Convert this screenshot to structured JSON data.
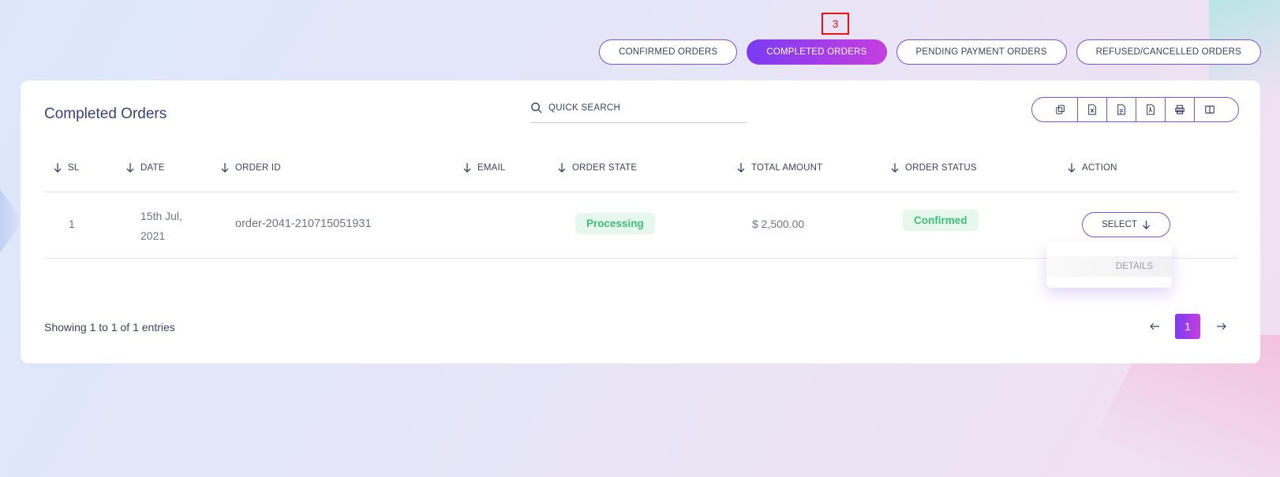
{
  "annotation_marker": "3",
  "tabs": [
    {
      "label": "CONFIRMED ORDERS",
      "active": false
    },
    {
      "label": "COMPLETED ORDERS",
      "active": true
    },
    {
      "label": "PENDING PAYMENT ORDERS",
      "active": false
    },
    {
      "label": "REFUSED/CANCELLED ORDERS",
      "active": false
    }
  ],
  "card": {
    "title": "Completed Orders",
    "search_label": "QUICK SEARCH",
    "toolbar_icons": [
      "copy-icon",
      "excel-icon",
      "csv-icon",
      "pdf-icon",
      "print-icon",
      "columns-icon"
    ]
  },
  "table": {
    "headers": [
      "SL",
      "DATE",
      "ORDER ID",
      "EMAIL",
      "ORDER STATE",
      "TOTAL AMOUNT",
      "ORDER STATUS",
      "ACTION"
    ],
    "rows": [
      {
        "sl": "1",
        "date_line1": "15th Jul,",
        "date_line2": "2021",
        "order_id": "order-2041-210715051931",
        "email": "",
        "order_state": "Processing",
        "total_amount": "$ 2,500.00",
        "order_status": "Confirmed",
        "action_label": "SELECT"
      }
    ]
  },
  "dropdown": {
    "items": [
      "DETAILS"
    ]
  },
  "footer": {
    "showing": "Showing 1 to 1 of 1 entries",
    "current_page": "1"
  },
  "colors": {
    "accent_start": "#7b3bf2",
    "accent_end": "#c63fe0",
    "status_green": "#3fbf78",
    "status_green_bg": "#e6f7ee"
  }
}
